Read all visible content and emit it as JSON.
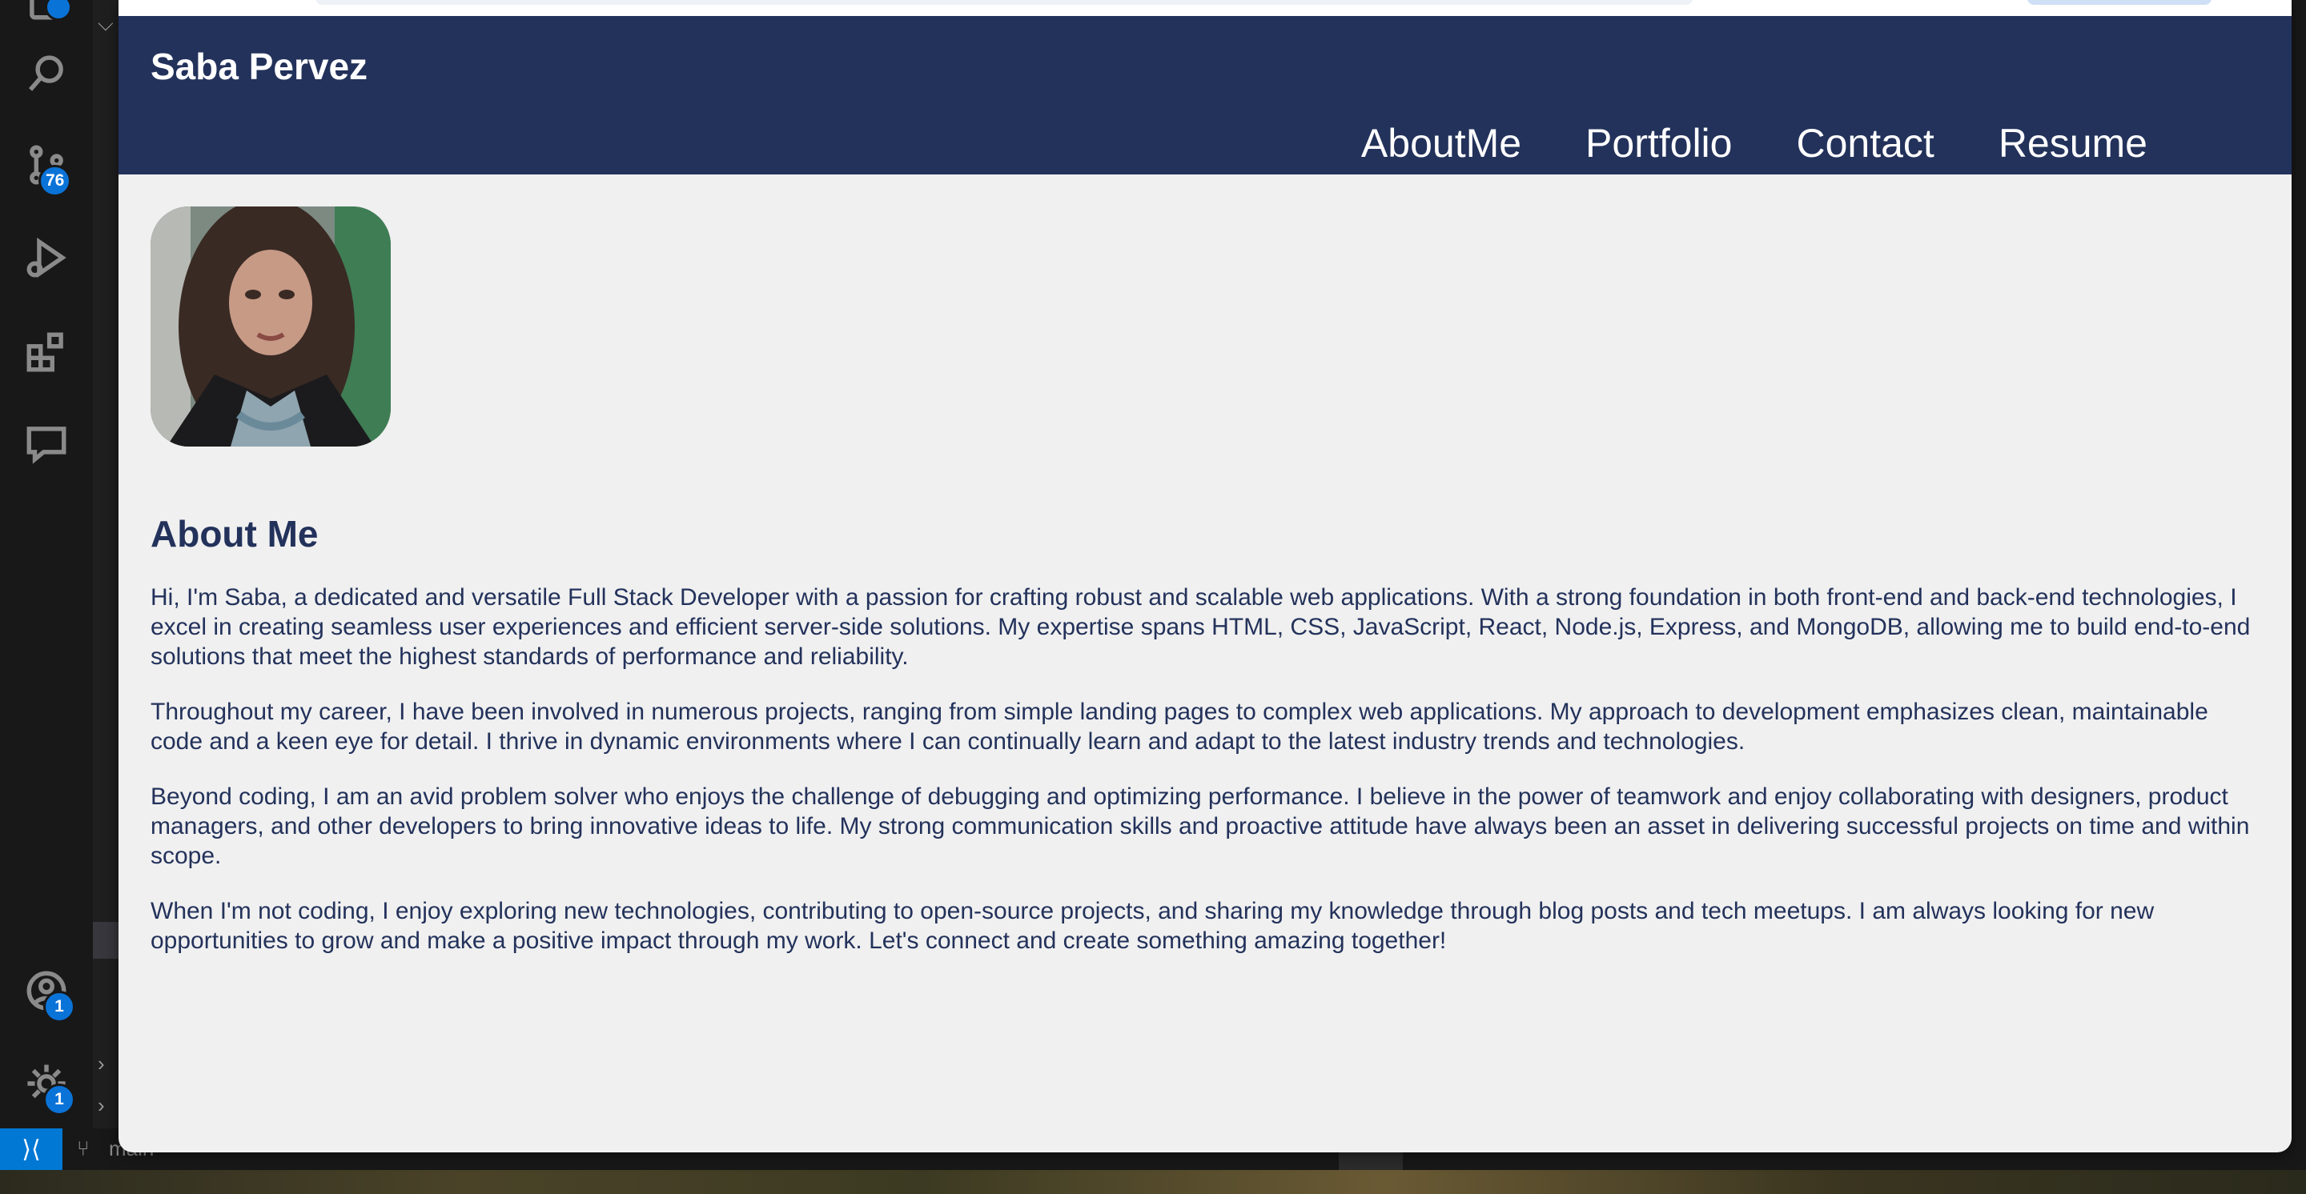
{
  "activity_bar": {
    "source_control_badge": "76",
    "account_badge": "1",
    "settings_badge": "1"
  },
  "status_bar": {
    "branch": "main"
  },
  "site": {
    "brand": "Saba Pervez",
    "nav": [
      "AboutMe",
      "Portfolio",
      "Contact",
      "Resume"
    ],
    "photo_alt": "Profile photo of Saba Pervez",
    "about": {
      "heading": "About Me",
      "paragraphs": [
        "Hi, I'm Saba, a dedicated and versatile Full Stack Developer with a passion for crafting robust and scalable web applications. With a strong foundation in both front-end and back-end technologies, I excel in creating seamless user experiences and efficient server-side solutions. My expertise spans HTML, CSS, JavaScript, React, Node.js, Express, and MongoDB, allowing me to build end-to-end solutions that meet the highest standards of performance and reliability.",
        "Throughout my career, I have been involved in numerous projects, ranging from simple landing pages to complex web applications. My approach to development emphasizes clean, maintainable code and a keen eye for detail. I thrive in dynamic environments where I can continually learn and adapt to the latest industry trends and technologies.",
        "Beyond coding, I am an avid problem solver who enjoys the challenge of debugging and optimizing performance. I believe in the power of teamwork and enjoy collaborating with designers, product managers, and other developers to bring innovative ideas to life. My strong communication skills and proactive attitude have always been an asset in delivering successful projects on time and within scope.",
        "When I'm not coding, I enjoy exploring new technologies, contributing to open-source projects, and sharing my knowledge through blog posts and tech meetups. I am always looking for new opportunities to grow and make a positive impact through my work. Let's connect and create something amazing together!"
      ]
    }
  },
  "icons": [
    "explorer-icon",
    "search-icon",
    "source-control-icon",
    "run-debug-icon",
    "extensions-icon",
    "chat-icon",
    "account-icon",
    "settings-gear-icon",
    "remote-icon",
    "branch-icon"
  ]
}
